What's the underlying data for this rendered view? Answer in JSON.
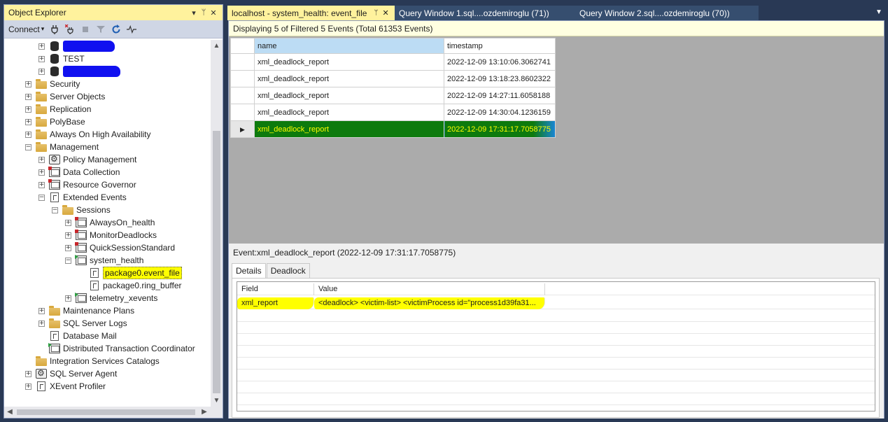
{
  "object_explorer": {
    "title": "Object Explorer",
    "title_controls": [
      "▾",
      "ᛘ",
      "✕"
    ],
    "toolbar": {
      "connect_label": "Connect",
      "connect_arrow": "▾"
    },
    "tree": [
      {
        "label": "",
        "redacted": true,
        "icon": "database-icon",
        "indent": 2,
        "expander": "+"
      },
      {
        "label": "TEST",
        "icon": "database-icon",
        "indent": 2,
        "expander": "+"
      },
      {
        "label": "",
        "redacted": true,
        "icon": "database-icon",
        "indent": 2,
        "expander": "+"
      },
      {
        "label": "Security",
        "icon": "folder-icon",
        "indent": 1,
        "expander": "+"
      },
      {
        "label": "Server Objects",
        "icon": "folder-icon",
        "indent": 1,
        "expander": "+"
      },
      {
        "label": "Replication",
        "icon": "folder-icon",
        "indent": 1,
        "expander": "+"
      },
      {
        "label": "PolyBase",
        "icon": "folder-icon",
        "indent": 1,
        "expander": "+"
      },
      {
        "label": "Always On High Availability",
        "icon": "folder-icon",
        "indent": 1,
        "expander": "+"
      },
      {
        "label": "Management",
        "icon": "folder-icon",
        "indent": 1,
        "expander": "−"
      },
      {
        "label": "Policy Management",
        "icon": "policy-icon",
        "indent": 2,
        "expander": "+"
      },
      {
        "label": "Data Collection",
        "icon": "data-collection-icon",
        "indent": 2,
        "expander": "+"
      },
      {
        "label": "Resource Governor",
        "icon": "resource-governor-icon",
        "indent": 2,
        "expander": "+"
      },
      {
        "label": "Extended Events",
        "icon": "extended-events-icon",
        "indent": 2,
        "expander": "−"
      },
      {
        "label": "Sessions",
        "icon": "folder-icon",
        "indent": 3,
        "expander": "−"
      },
      {
        "label": "AlwaysOn_health",
        "icon": "session-stopped-icon",
        "indent": 4,
        "expander": "+"
      },
      {
        "label": "MonitorDeadlocks",
        "icon": "session-stopped-icon",
        "indent": 4,
        "expander": "+"
      },
      {
        "label": "QuickSessionStandard",
        "icon": "session-stopped-icon",
        "indent": 4,
        "expander": "+"
      },
      {
        "label": "system_health",
        "icon": "session-running-icon",
        "indent": 4,
        "expander": "−"
      },
      {
        "label": "package0.event_file",
        "icon": "target-icon",
        "indent": 5,
        "expander": "",
        "highlight": true
      },
      {
        "label": "package0.ring_buffer",
        "icon": "target-icon",
        "indent": 5,
        "expander": ""
      },
      {
        "label": "telemetry_xevents",
        "icon": "session-running-icon",
        "indent": 4,
        "expander": "+"
      },
      {
        "label": "Maintenance Plans",
        "icon": "folder-icon",
        "indent": 2,
        "expander": "+"
      },
      {
        "label": "SQL Server Logs",
        "icon": "folder-icon",
        "indent": 2,
        "expander": "+"
      },
      {
        "label": "Database Mail",
        "icon": "database-mail-icon",
        "indent": 2,
        "expander": ""
      },
      {
        "label": "Distributed Transaction Coordinator",
        "icon": "dtc-icon",
        "indent": 2,
        "expander": ""
      },
      {
        "label": "Integration Services Catalogs",
        "icon": "folder-icon",
        "indent": 1,
        "expander": ""
      },
      {
        "label": "SQL Server Agent",
        "icon": "sql-agent-icon",
        "indent": 1,
        "expander": "+"
      },
      {
        "label": "XEvent Profiler",
        "icon": "xevent-profiler-icon",
        "indent": 1,
        "expander": "+"
      }
    ]
  },
  "tabs": [
    {
      "label": "localhost - system_health: event_file",
      "pin": "ᛘ",
      "close": "✕",
      "active": true
    },
    {
      "label": "Query Window 1.sql....ozdemiroglu (71))",
      "active": false
    },
    {
      "label": "Query Window 2.sql....ozdemiroglu (70))",
      "active": false
    }
  ],
  "info_bar": "Displaying 5 of Filtered 5 Events (Total 61353 Events)",
  "events": {
    "columns": [
      "name",
      "timestamp"
    ],
    "rows": [
      {
        "name": "xml_deadlock_report",
        "timestamp": "2022-12-09 13:10:06.3062741"
      },
      {
        "name": "xml_deadlock_report",
        "timestamp": "2022-12-09 13:18:23.8602322"
      },
      {
        "name": "xml_deadlock_report",
        "timestamp": "2022-12-09 14:27:11.6058188"
      },
      {
        "name": "xml_deadlock_report",
        "timestamp": "2022-12-09 14:30:04.1236159"
      },
      {
        "name": "xml_deadlock_report",
        "timestamp": "2022-12-09 17:31:17.7058775",
        "selected": true
      }
    ]
  },
  "detail": {
    "title": "Event:xml_deadlock_report (2022-12-09 17:31:17.7058775)",
    "tabs": [
      "Details",
      "Deadlock"
    ],
    "columns": [
      "Field",
      "Value"
    ],
    "rows": [
      {
        "field": "xml_report",
        "value": "<deadlock>   <victim-list>   <victimProcess id=\"process1d39fa31..."
      }
    ]
  },
  "colors": {
    "accent": "#fff29d",
    "selection": "#0d7a0d",
    "selection_text": "#ffff00",
    "frame": "#293955"
  }
}
